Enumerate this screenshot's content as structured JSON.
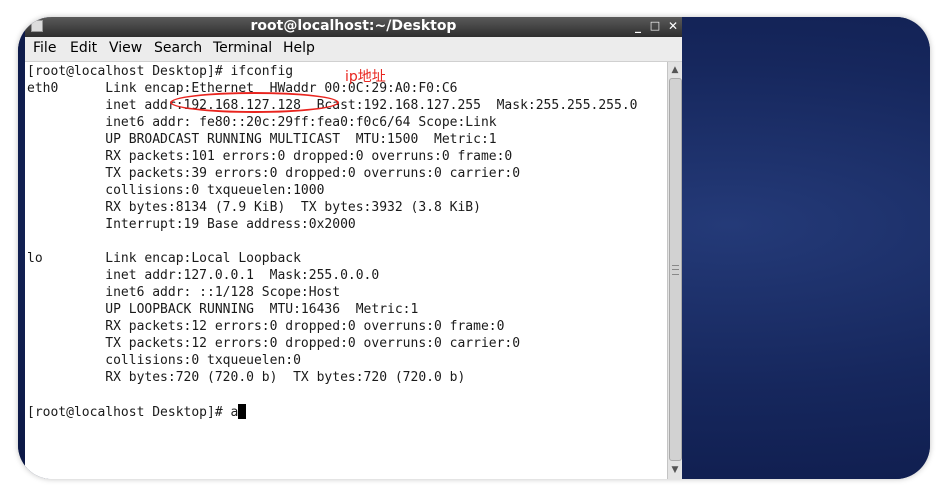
{
  "window": {
    "title": "root@localhost:~/Desktop",
    "minimize": "_",
    "maximize": "□",
    "close": "✕"
  },
  "menu": [
    "File",
    "Edit",
    "View",
    "Search",
    "Terminal",
    "Help"
  ],
  "terminal": {
    "lines": [
      "[root@localhost Desktop]# ifconfig",
      "eth0      Link encap:Ethernet  HWaddr 00:0C:29:A0:F0:C6",
      "          inet addr:192.168.127.128  Bcast:192.168.127.255  Mask:255.255.255.0",
      "          inet6 addr: fe80::20c:29ff:fea0:f0c6/64 Scope:Link",
      "          UP BROADCAST RUNNING MULTICAST  MTU:1500  Metric:1",
      "          RX packets:101 errors:0 dropped:0 overruns:0 frame:0",
      "          TX packets:39 errors:0 dropped:0 overruns:0 carrier:0",
      "          collisions:0 txqueuelen:1000",
      "          RX bytes:8134 (7.9 KiB)  TX bytes:3932 (3.8 KiB)",
      "          Interrupt:19 Base address:0x2000",
      "",
      "lo        Link encap:Local Loopback",
      "          inet addr:127.0.0.1  Mask:255.0.0.0",
      "          inet6 addr: ::1/128 Scope:Host",
      "          UP LOOPBACK RUNNING  MTU:16436  Metric:1",
      "          RX packets:12 errors:0 dropped:0 overruns:0 frame:0",
      "          TX packets:12 errors:0 dropped:0 overruns:0 carrier:0",
      "          collisions:0 txqueuelen:0",
      "          RX bytes:720 (720.0 b)  TX bytes:720 (720.0 b)",
      "",
      "[root@localhost Desktop]# a"
    ]
  },
  "annotation": {
    "label": "ip地址",
    "color": "#e8241e"
  }
}
